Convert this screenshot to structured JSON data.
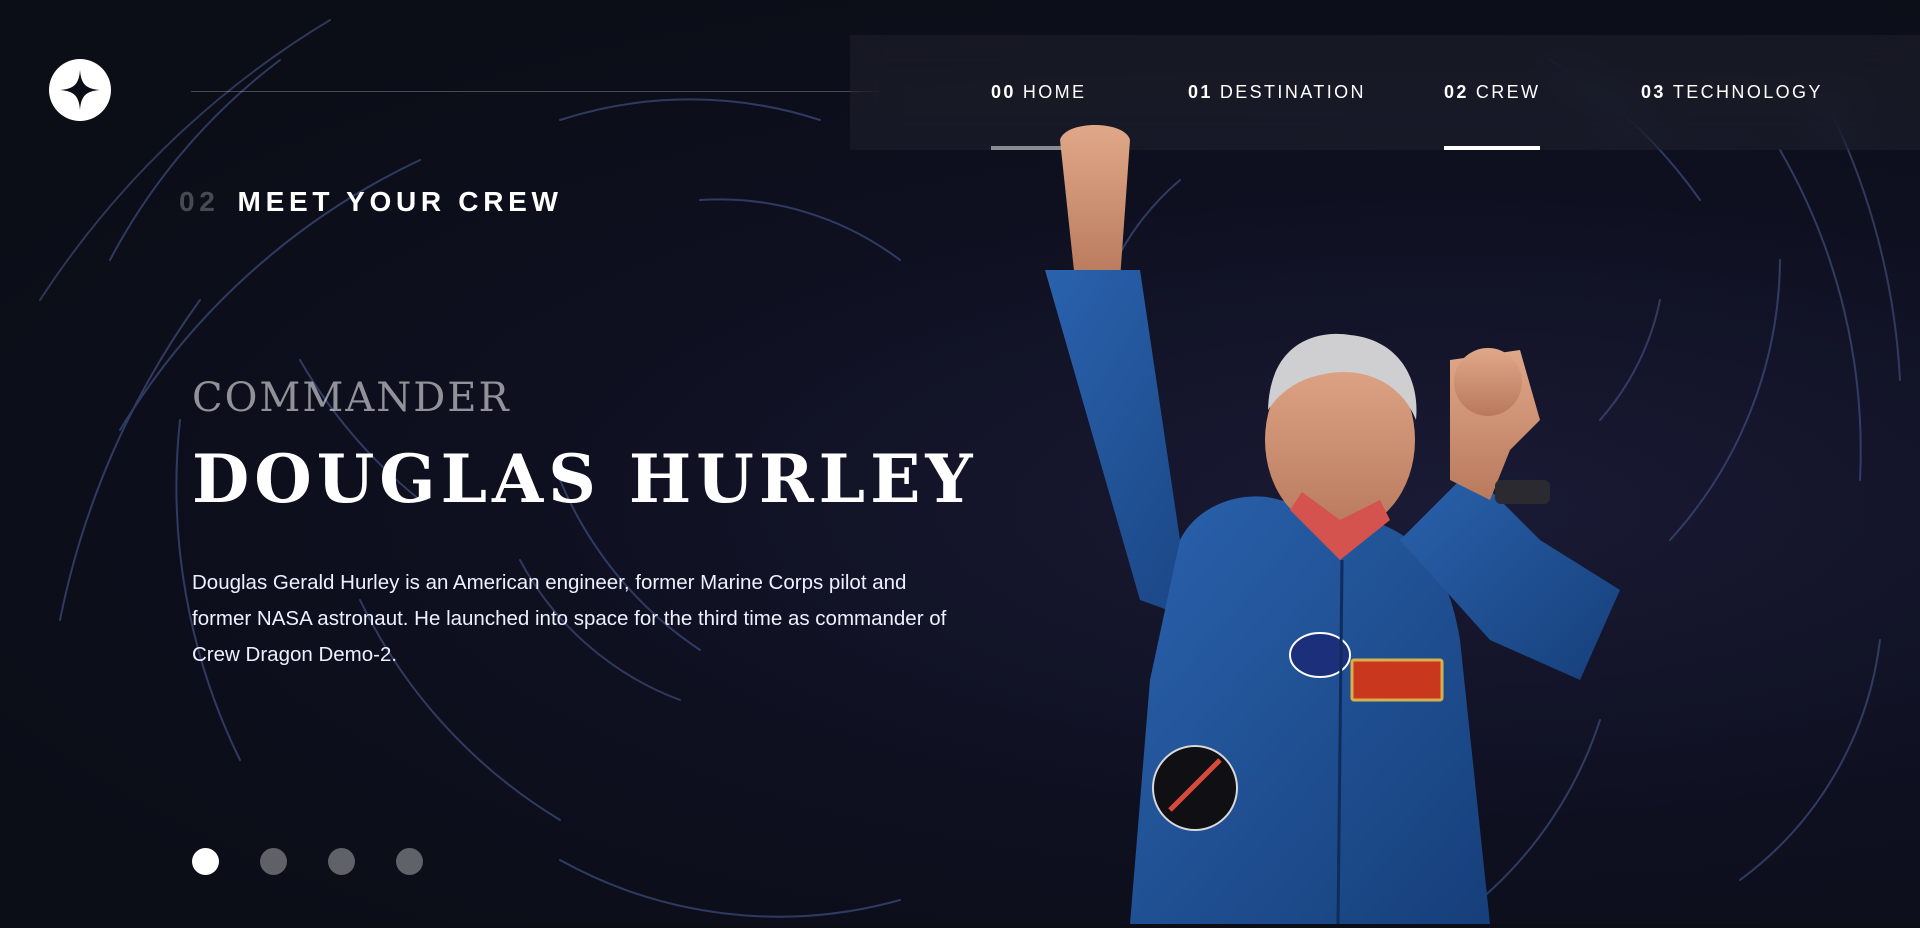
{
  "brand": {
    "logo_icon": "star-logo-icon"
  },
  "nav": {
    "items": [
      {
        "num": "00",
        "label": "HOME",
        "state": "hover"
      },
      {
        "num": "01",
        "label": "DESTINATION",
        "state": "normal"
      },
      {
        "num": "02",
        "label": "CREW",
        "state": "active"
      },
      {
        "num": "03",
        "label": "TECHNOLOGY",
        "state": "normal"
      }
    ]
  },
  "page": {
    "index": "02",
    "title": "MEET YOUR CREW"
  },
  "crew": {
    "role": "COMMANDER",
    "name": "DOUGLAS HURLEY",
    "bio": "Douglas Gerald Hurley is an American engineer, former Marine Corps pilot and former NASA astronaut. He launched into space for the third time as commander of Crew Dragon Demo-2."
  },
  "carousel": {
    "count": 4,
    "active_index": 0
  },
  "colors": {
    "background": "#0b0d17",
    "accent": "#ffffff",
    "suit": "#1d4f93"
  }
}
